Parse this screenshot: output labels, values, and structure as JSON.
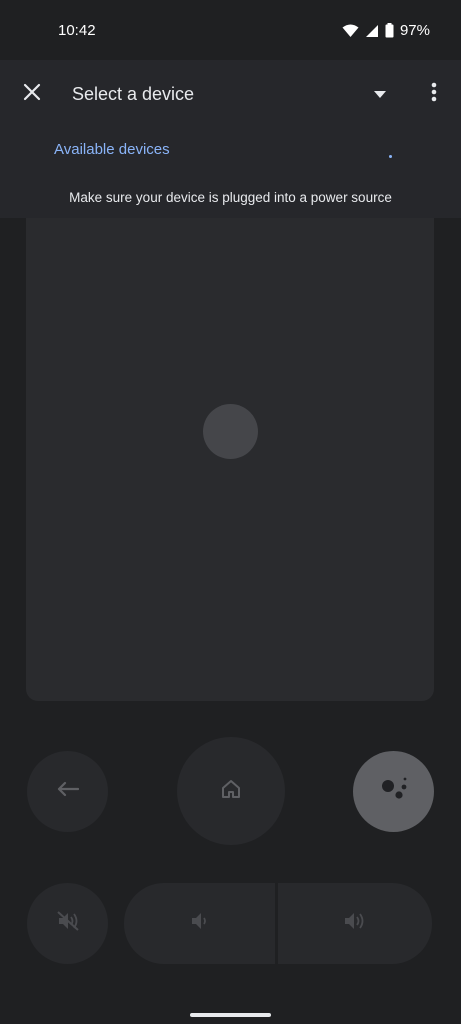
{
  "status_bar": {
    "time": "10:42",
    "battery": "97%",
    "icons": [
      "wifi-icon",
      "cell-signal-icon",
      "battery-icon"
    ]
  },
  "header": {
    "title": "Select a device",
    "close_icon": "close-icon",
    "dropdown_icon": "dropdown-arrow-icon",
    "more_icon": "more-vert-icon"
  },
  "devices": {
    "section_label": "Available devices",
    "hint": "Make sure your device is plugged into a power source"
  },
  "remote": {
    "buttons": [
      "back-icon",
      "home-icon",
      "assistant-icon",
      "mute-icon",
      "volume-down-icon",
      "volume-up-icon"
    ]
  },
  "colors": {
    "background": "#1f2022",
    "sheet": "#26272b",
    "accent": "#8ab4f8",
    "button": "#28292c",
    "assistant_button": "#5f6064"
  }
}
